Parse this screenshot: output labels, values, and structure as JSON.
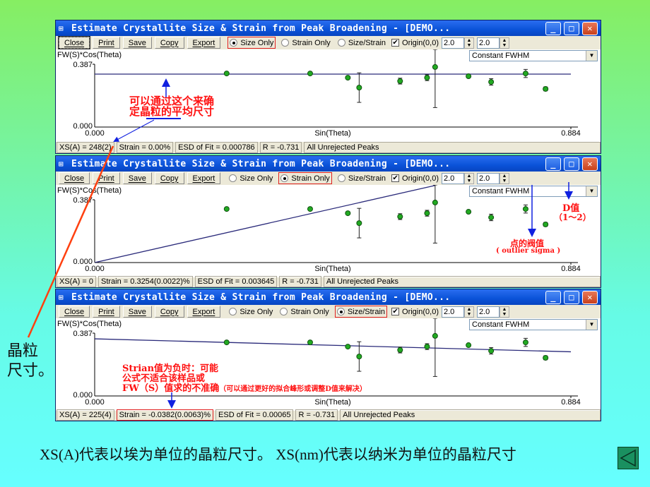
{
  "colors": {
    "title_bar": "#0a52d8",
    "point_fill": "#22aa22",
    "fit_line": "#2a2a7a",
    "annotation_red": "#ff1010",
    "arrow_blue": "#1020e0",
    "pointer_orange": "#ff4010",
    "back_button": "#1a9060"
  },
  "windows": [
    {
      "title": "Estimate Crystallite Size & Strain from Peak Broadening - [DEMO...",
      "buttons": [
        "Close",
        "Print",
        "Save",
        "Copy",
        "Export"
      ],
      "radios": [
        "Size Only",
        "Strain Only",
        "Size/Strain"
      ],
      "selected_radio": 0,
      "origin_label": "Origin(0,0)",
      "origin_checked": true,
      "spin1": "2.0",
      "spin2": "2.0",
      "dropdown": "Constant FWHM",
      "y_label": "FW(S)*Cos(Theta)",
      "y_max": "0.387",
      "y_min": "0.000",
      "x_min": "0.000",
      "x_max": "0.884",
      "x_label": "Sin(Theta)",
      "status": [
        "XS(A) = 248(2)",
        "Strain = 0.00%",
        "ESD of Fit = 0.000786",
        "R = -0.731",
        "All Unrejected Peaks"
      ],
      "status_highlight": -1
    },
    {
      "title": "Estimate Crystallite Size & Strain from Peak Broadening - [DEMO...",
      "buttons": [
        "Close",
        "Print",
        "Save",
        "Copy",
        "Export"
      ],
      "radios": [
        "Size Only",
        "Strain Only",
        "Size/Strain"
      ],
      "selected_radio": 1,
      "origin_label": "Origin(0,0)",
      "origin_checked": true,
      "spin1": "2.0",
      "spin2": "2.0",
      "dropdown": "Constant FWHM",
      "y_label": "FW(S)*Cos(Theta)",
      "y_max": "0.387",
      "y_min": "0.000",
      "x_min": "0.000",
      "x_max": "0.884",
      "x_label": "Sin(Theta)",
      "status": [
        "XS(A) = 0",
        "Strain = 0.3254(0.0022)%",
        "ESD of Fit = 0.003645",
        "R = -0.731",
        "All Unrejected Peaks"
      ],
      "status_highlight": -1
    },
    {
      "title": "Estimate Crystallite Size & Strain from Peak Broadening - [DEMO...",
      "buttons": [
        "Close",
        "Print",
        "Save",
        "Copy",
        "Export"
      ],
      "radios": [
        "Size Only",
        "Strain Only",
        "Size/Strain"
      ],
      "selected_radio": 2,
      "origin_label": "Origin(0,0)",
      "origin_checked": true,
      "spin1": "2.0",
      "spin2": "2.0",
      "dropdown": "Constant FWHM",
      "y_label": "FW(S)*Cos(Theta)",
      "y_max": "0.387",
      "y_min": "0.000",
      "x_min": "0.000",
      "x_max": "0.884",
      "x_label": "Sin(Theta)",
      "status": [
        "XS(A) = 225(4)",
        "Strain = -0.0382(0.0063)%",
        "ESD of Fit = 0.00065",
        "R = -0.731",
        "All Unrejected Peaks"
      ],
      "status_highlight": 1
    }
  ],
  "chart_data": [
    {
      "type": "scatter",
      "xlim": [
        0,
        0.884
      ],
      "ylim": [
        0,
        0.387
      ],
      "xlabel": "Sin(Theta)",
      "ylabel": "FW(S)*Cos(Theta)",
      "points": [
        {
          "x": 0.245,
          "y": 0.33,
          "err": 0.004
        },
        {
          "x": 0.4,
          "y": 0.33,
          "err": 0.004
        },
        {
          "x": 0.47,
          "y": 0.304,
          "err": 0.008
        },
        {
          "x": 0.491,
          "y": 0.243,
          "err": 0.091
        },
        {
          "x": 0.567,
          "y": 0.283,
          "err": 0.018
        },
        {
          "x": 0.617,
          "y": 0.304,
          "err": 0.018
        },
        {
          "x": 0.632,
          "y": 0.37,
          "err": 0.25
        },
        {
          "x": 0.694,
          "y": 0.313,
          "err": 0.006
        },
        {
          "x": 0.736,
          "y": 0.278,
          "err": 0.02
        },
        {
          "x": 0.8,
          "y": 0.33,
          "err": 0.025
        },
        {
          "x": 0.837,
          "y": 0.235,
          "err": 0.012
        }
      ],
      "fit_line": [
        [
          0,
          0.326
        ],
        [
          0.884,
          0.326
        ]
      ]
    },
    {
      "type": "scatter",
      "xlim": [
        0,
        0.884
      ],
      "ylim": [
        0,
        0.387
      ],
      "fit_line": [
        [
          0,
          0
        ],
        [
          0.632,
          0.475
        ]
      ]
    },
    {
      "type": "scatter",
      "xlim": [
        0,
        0.884
      ],
      "ylim": [
        0,
        0.387
      ],
      "fit_line": [
        [
          0,
          0.352
        ],
        [
          0.884,
          0.272
        ]
      ]
    }
  ],
  "annotations": {
    "w1_note": [
      "可以通过这个来确",
      "定晶粒的平均尺寸"
    ],
    "side_label": [
      "晶粒",
      "尺寸。"
    ],
    "outlier_title": "点的阀值",
    "outlier_sub": "( outlier sigma )",
    "d_title": "D值",
    "d_sub": "（1～2）",
    "w3_note": [
      "Strian值为负时：可能",
      "公式不适合该样品或",
      "FW（S）值求的不准确"
    ],
    "w3_note_small": "（可以通过更好的拟合峰形或调整D值来解决）"
  },
  "caption": "XS(A)代表以埃为单位的晶粒尺寸。 XS(nm)代表以纳米为单位的晶粒尺寸"
}
